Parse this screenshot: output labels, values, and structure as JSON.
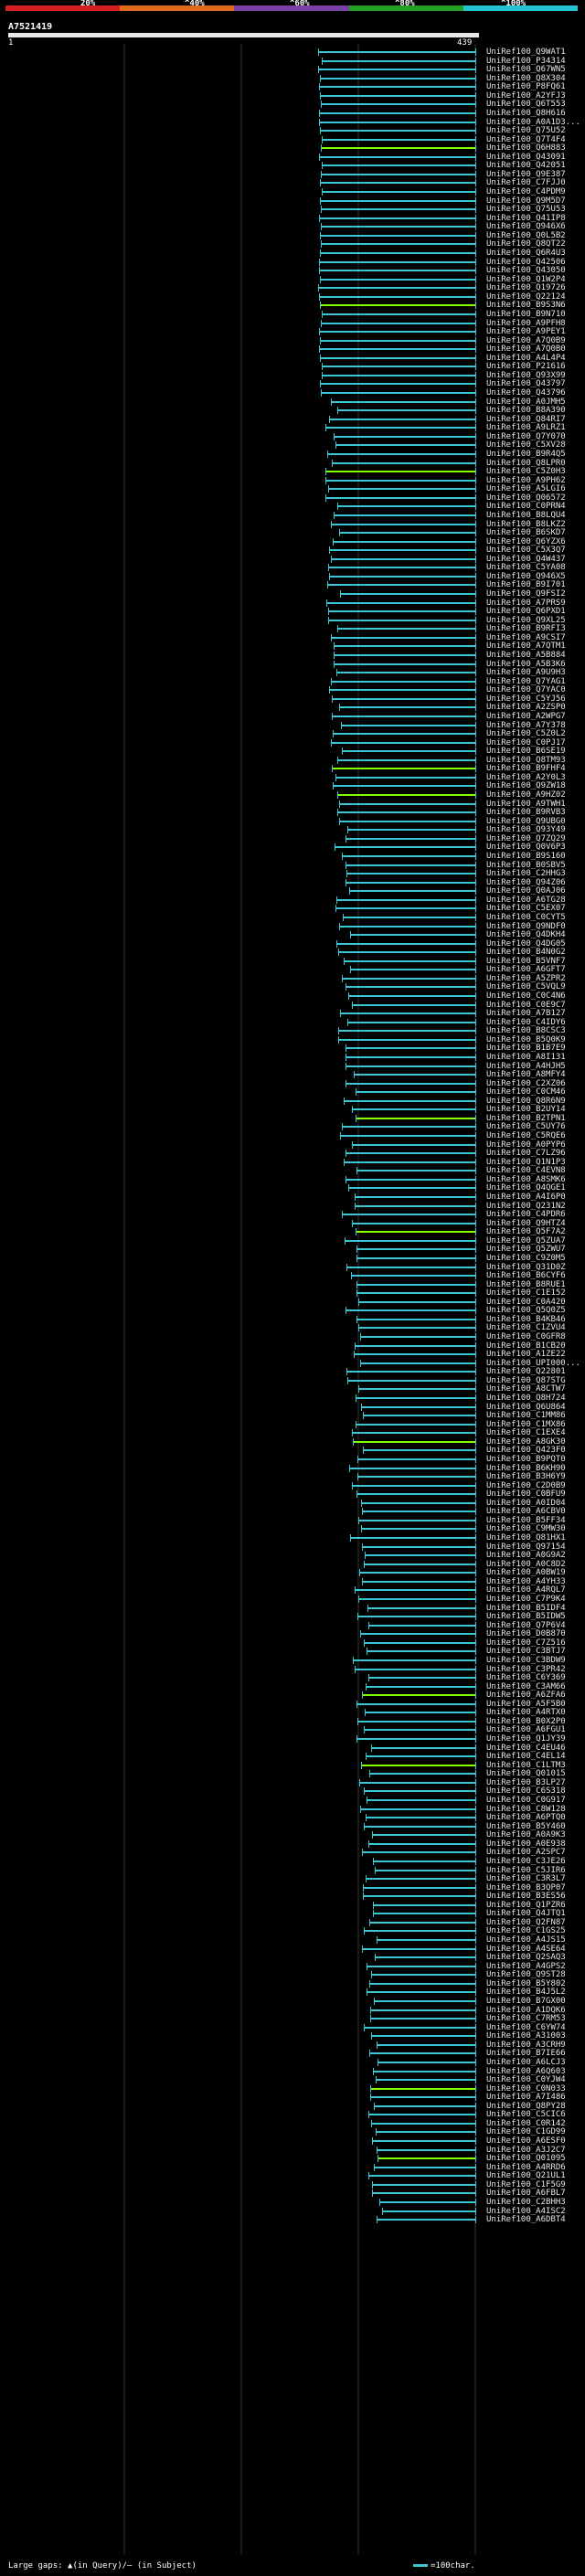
{
  "header": {
    "scale_labels": [
      "20%",
      "^40%",
      "^60%",
      "^80%",
      "^100%"
    ],
    "scale_colors": [
      "#d42020",
      "#e06a1a",
      "#7b3fa8",
      "#22a022",
      "#24c2d4"
    ],
    "query_name": "A7521419",
    "coord_start": "1",
    "coord_end": "439"
  },
  "colors": {
    "hit_line": "#3ac7d3",
    "gap_line": "#7fff00",
    "grid": "#333333"
  },
  "footer": {
    "text": "Large gaps: ▲(in Query)/— (in Subject)"
  },
  "legend": {
    "text": "=100char."
  },
  "hits": [
    "UniRef100_Q9WAT1",
    "UniRef100_P34314",
    "UniRef100_Q67WN5",
    "UniRef100_Q8X304",
    "UniRef100_P8FQ61",
    "UniRef100_A2YFJ3",
    "UniRef100_Q6T553",
    "UniRef100_Q8H616",
    "UniRef100_A0A1D3...",
    "UniRef100_Q75U52",
    "UniRef100_Q7T4F4",
    "UniRef100_Q6H883",
    "UniRef100_Q43091",
    "UniRef100_Q42051",
    "UniRef100_Q9E387",
    "UniRef100_C7FJJ0",
    "UniRef100_C4PDM9",
    "UniRef100_Q9M5D7",
    "UniRef100_Q75U53",
    "UniRef100_Q41IP8",
    "UniRef100_Q946X6",
    "UniRef100_Q0L5B2",
    "UniRef100_Q8QT22",
    "UniRef100_Q6R4U3",
    "UniRef100_Q42506",
    "UniRef100_Q43050",
    "UniRef100_Q1W2P4",
    "UniRef100_Q19726",
    "UniRef100_Q22124",
    "UniRef100_B9S3N6",
    "UniRef100_B9N710",
    "UniRef100_A9PFH8",
    "UniRef100_A9PEY1",
    "UniRef100_A7Q0B9",
    "UniRef100_A7Q0B0",
    "UniRef100_A4L4P4",
    "UniRef100_P21616",
    "UniRef100_Q93X99",
    "UniRef100_Q43797",
    "UniRef100_Q43796",
    "UniRef100_A0JMH5",
    "UniRef100_B8A390",
    "UniRef100_Q84RI7",
    "UniRef100_A9LRZ1",
    "UniRef100_Q7Y070",
    "UniRef100_C5XV28",
    "UniRef100_B9R4Q5",
    "UniRef100_Q8LPR0",
    "UniRef100_C5Z0H3",
    "UniRef100_A9PH62",
    "UniRef100_A5LGI6",
    "UniRef100_Q06572",
    "UniRef100_C0PRN4",
    "UniRef100_B8LQU4",
    "UniRef100_B8LKZ2",
    "UniRef100_B6SKD7",
    "UniRef100_Q6YZX6",
    "UniRef100_C5X3Q7",
    "UniRef100_Q4W437",
    "UniRef100_C5YA08",
    "UniRef100_Q946X5",
    "UniRef100_B9I701",
    "UniRef100_Q9FSI2",
    "UniRef100_A7PRS9",
    "UniRef100_Q6PXD1",
    "UniRef100_Q9XL25",
    "UniRef100_B9RFI3",
    "UniRef100_A9CSI7",
    "UniRef100_A7QTM1",
    "UniRef100_A5B884",
    "UniRef100_A5B3K6",
    "UniRef100_A9U9H3",
    "UniRef100_Q7YAG1",
    "UniRef100_Q7YAC0",
    "UniRef100_C5YJ56",
    "UniRef100_A2ZSP0",
    "UniRef100_A2WPG7",
    "UniRef100_A7Y378",
    "UniRef100_C5Z0L2",
    "UniRef100_C0PJ17",
    "UniRef100_B6SE19",
    "UniRef100_Q8TM93",
    "UniRef100_B9FHF4",
    "UniRef100_A2Y0L3",
    "UniRef100_Q9ZW18",
    "UniRef100_A9HZ02",
    "UniRef100_A9TWH1",
    "UniRef100_B9RVB3",
    "UniRef100_Q9UBG0",
    "UniRef100_Q93Y49",
    "UniRef100_Q7ZQ29",
    "UniRef100_Q0V6P3",
    "UniRef100_B9S160",
    "UniRef100_B0SBV5",
    "UniRef100_C2HHG3",
    "UniRef100_Q94Z06",
    "UniRef100_Q0AJ06",
    "UniRef100_A6TG28",
    "UniRef100_C5EX07",
    "UniRef100_C0CYT5",
    "UniRef100_Q9NDF0",
    "UniRef100_Q4DKH4",
    "UniRef100_Q4DG05",
    "UniRef100_B4N0G2",
    "UniRef100_B5VNF7",
    "UniRef100_A6GFT7",
    "UniRef100_A5ZPR2",
    "UniRef100_C5VQL9",
    "UniRef100_C0C4N6",
    "UniRef100_C0E9C7",
    "UniRef100_A7B127",
    "UniRef100_C4IDY6",
    "UniRef100_B8CSC3",
    "UniRef100_B5Q0K9",
    "UniRef100_B1B7E9",
    "UniRef100_A8I131",
    "UniRef100_A4HJH5",
    "UniRef100_A8MFY4",
    "UniRef100_C2XZ06",
    "UniRef100_C0CM46",
    "UniRef100_Q8R6N9",
    "UniRef100_B2UY14",
    "UniRef100_B2TPN1",
    "UniRef100_C5UY76",
    "UniRef100_C5RQE6",
    "UniRef100_A0PYP6",
    "UniRef100_C7LZ96",
    "UniRef100_Q1N1P3",
    "UniRef100_C4EVN8",
    "UniRef100_A8SMK6",
    "UniRef100_Q4QGE1",
    "UniRef100_A4I6P0",
    "UniRef100_Q231N2",
    "UniRef100_C4PDR6",
    "UniRef100_Q9HTZ4",
    "UniRef100_Q5F7A2",
    "UniRef100_Q5ZUA7",
    "UniRef100_Q5ZWU7",
    "UniRef100_C9Z0M5",
    "UniRef100_Q31D0Z",
    "UniRef100_B6CYF6",
    "UniRef100_B8RUE1",
    "UniRef100_C1E152",
    "UniRef100_C0A420",
    "UniRef100_Q5Q0Z5",
    "UniRef100_B4KB46",
    "UniRef100_C1ZVU4",
    "UniRef100_C0GFR8",
    "UniRef100_B1CB20",
    "UniRef100_A1ZE22",
    "UniRef100_UPI000...",
    "UniRef100_Q22801",
    "UniRef100_Q87STG",
    "UniRef100_A8CTW7",
    "UniRef100_Q8H724",
    "UniRef100_Q6U864",
    "UniRef100_C1MM86",
    "UniRef100_C1MX86",
    "UniRef100_C1EXE4",
    "UniRef100_A8GK30",
    "UniRef100_Q423F0",
    "UniRef100_B9PQT0",
    "UniRef100_B6KH90",
    "UniRef100_B3H6Y9",
    "UniRef100_C2D0B9",
    "UniRef100_C0BFU9",
    "UniRef100_A0ID04",
    "UniRef100_A6CBV0",
    "UniRef100_B5FF34",
    "UniRef100_C9MW30",
    "UniRef100_Q81HX1",
    "UniRef100_Q97154",
    "UniRef100_A0G9A2",
    "UniRef100_A0C8D2",
    "UniRef100_A0BW19",
    "UniRef100_A4YH33",
    "UniRef100_A4RQL7",
    "UniRef100_C7P9K4",
    "UniRef100_B5IDF4",
    "UniRef100_B5IDW5",
    "UniRef100_Q7P6V4",
    "UniRef100_D0B870",
    "UniRef100_C7Z516",
    "UniRef100_C3BTJ7",
    "UniRef100_C3BDW9",
    "UniRef100_C3PR42",
    "UniRef100_C6Y369",
    "UniRef100_C3AM66",
    "UniRef100_A6ZFA6",
    "UniRef100_A5F5B0",
    "UniRef100_A4RTX0",
    "UniRef100_B0X2P0",
    "UniRef100_A6FGU1",
    "UniRef100_Q1JY39",
    "UniRef100_C4EU46",
    "UniRef100_C4EL14",
    "UniRef100_C1LTM3",
    "UniRef100_Q01015",
    "UniRef100_B3LP27",
    "UniRef100_C6S318",
    "UniRef100_C0G917",
    "UniRef100_C8W128",
    "UniRef100_A6PTQ0",
    "UniRef100_B5Y460",
    "UniRef100_A0A9K3",
    "UniRef100_A0E938",
    "UniRef100_A2SPC7",
    "UniRef100_C3JE26",
    "UniRef100_C5JIR6",
    "UniRef100_C3R3L7",
    "UniRef100_B3QP07",
    "UniRef100_B3ES56",
    "UniRef100_Q1PZR6",
    "UniRef100_Q4JTQ1",
    "UniRef100_Q2FN87",
    "UniRef100_C1GS25",
    "UniRef100_A4JS15",
    "UniRef100_A4SE64",
    "UniRef100_Q2SAQ3",
    "UniRef100_A4GPS2",
    "UniRef100_Q9ST28",
    "UniRef100_B5Y802",
    "UniRef100_B4J5L2",
    "UniRef100_B7GX00",
    "UniRef100_A1DQK6",
    "UniRef100_C7RM53",
    "UniRef100_C6YW74",
    "UniRef100_A31003",
    "UniRef100_A3CRH9",
    "UniRef100_B7IE66",
    "UniRef100_A6LCJ3",
    "UniRef100_A6Q603",
    "UniRef100_C0YJW4",
    "UniRef100_C0N033",
    "UniRef100_A7I486",
    "UniRef100_Q8PY28",
    "UniRef100_C5CIC6",
    "UniRef100_C0R142",
    "UniRef100_C1GD99",
    "UniRef100_A6ESF0",
    "UniRef100_A3J2C7",
    "UniRef100_Q01095",
    "UniRef100_A4RRD6",
    "UniRef100_Q21UL1",
    "UniRef100_C1F5G9",
    "UniRef100_A6FBL7",
    "UniRef100_C2BHH3",
    "UniRef100_A4ISC2",
    "UniRef100_A6DBT4"
  ]
}
